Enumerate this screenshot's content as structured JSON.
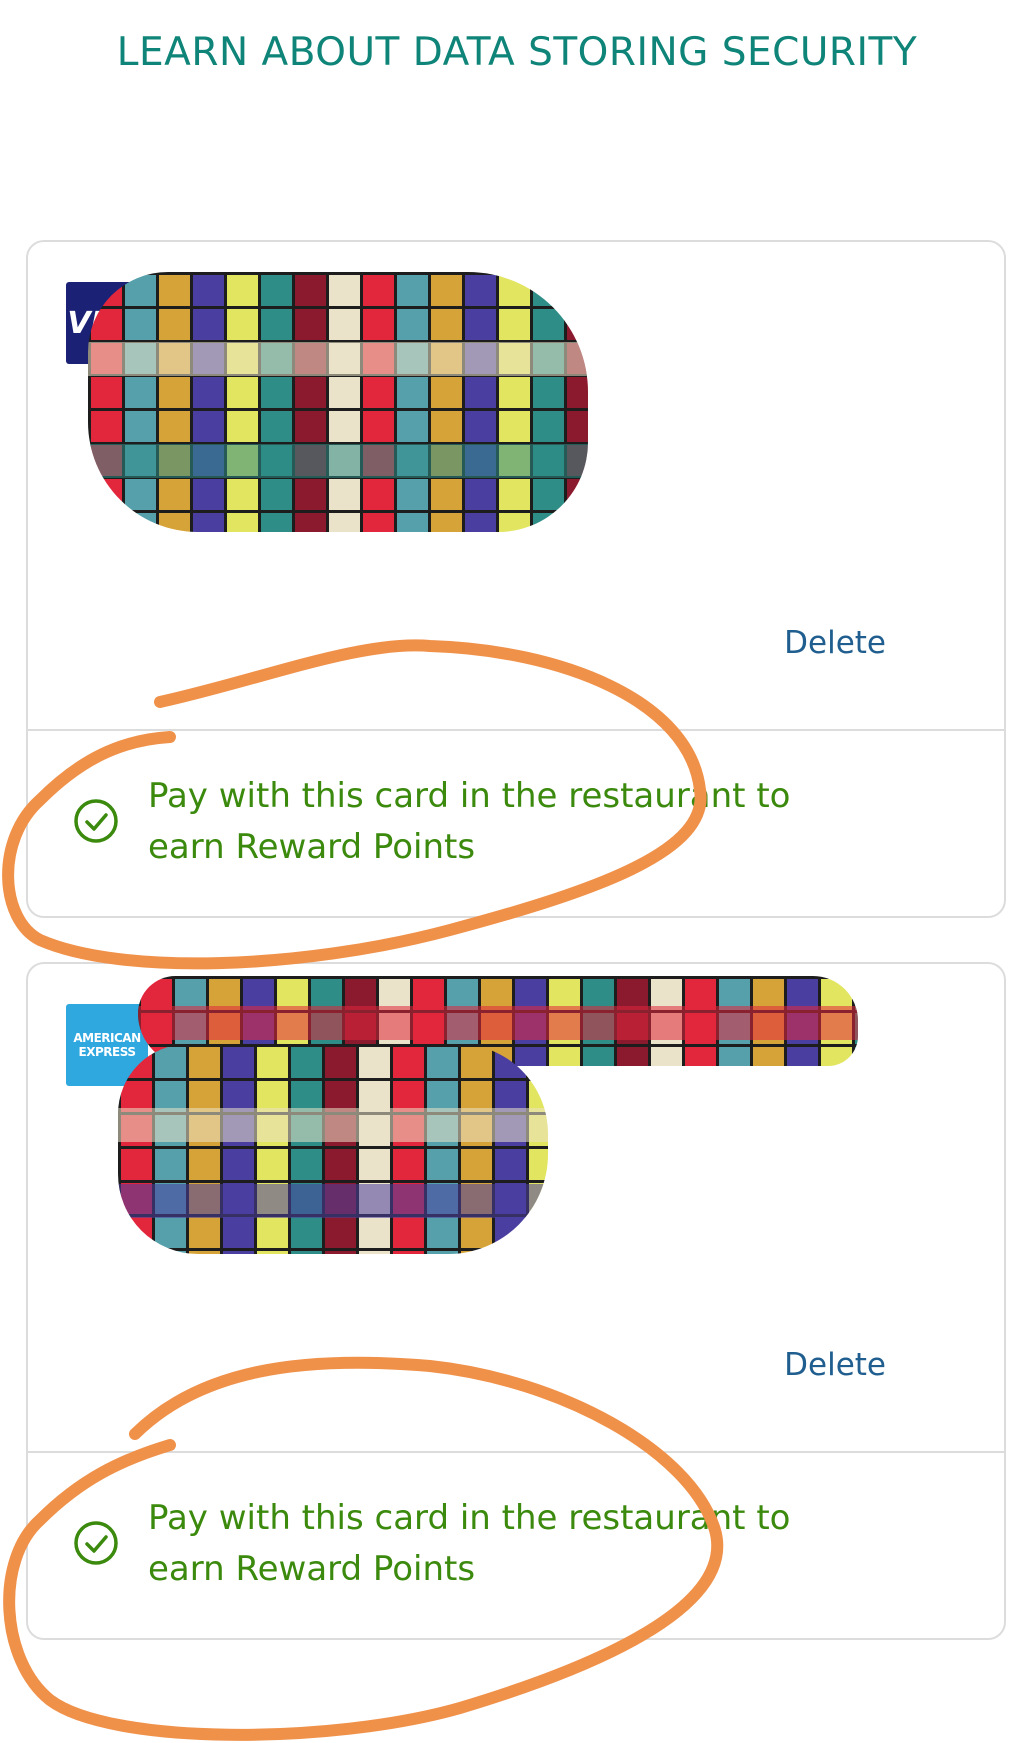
{
  "header": {
    "security_link": "LEARN ABOUT DATA STORING SECURITY"
  },
  "cards": [
    {
      "brand": "VISA",
      "brand_icon": "visa-logo",
      "delete_label": "Delete",
      "reward_text": "Pay with this card in the restaurant to earn Reward Points",
      "reward_icon": "check-circle-icon"
    },
    {
      "brand": "AMERICAN EXPRESS",
      "brand_line1": "AMERICAN",
      "brand_line2": "EXPRESS",
      "brand_icon": "amex-logo",
      "delete_label": "Delete",
      "reward_text": "Pay with this card in the restaurant to earn Reward Points",
      "reward_icon": "check-circle-icon"
    }
  ],
  "colors": {
    "accent_teal": "#0f8478",
    "reward_green": "#3b8a0e",
    "delete_blue": "#1f5e8f",
    "annotation_orange": "#f0914a"
  }
}
